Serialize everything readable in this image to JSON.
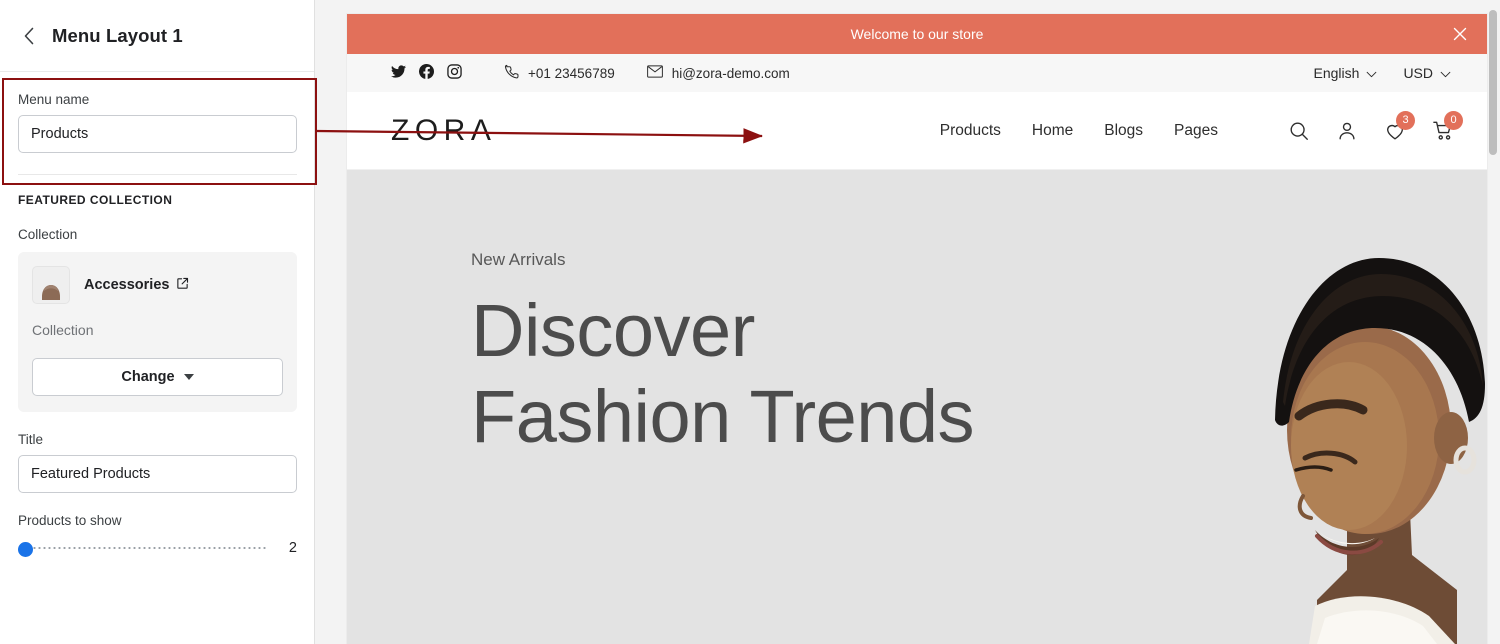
{
  "sidebar": {
    "back_icon": "chevron-left-icon",
    "title": "Menu Layout 1",
    "menu_name": {
      "label": "Menu name",
      "value": "Products"
    },
    "featured_collection": {
      "section_title": "FEATURED COLLECTION",
      "collection_label": "Collection",
      "collection_name": "Accessories",
      "external_link_icon": "external-link-icon",
      "collection_type": "Collection",
      "change_button": "Change",
      "change_caret_icon": "caret-down-icon"
    },
    "title_field": {
      "label": "Title",
      "value": "Featured Products"
    },
    "products_to_show": {
      "label": "Products to show",
      "value": "2"
    }
  },
  "annotation": {
    "box_color": "#8c1010",
    "arrow_color": "#8c1010",
    "target": "Products"
  },
  "preview": {
    "promo_bar": {
      "text": "Welcome to our store",
      "background": "#e2705a",
      "close_icon": "close-icon"
    },
    "topbar": {
      "socials": [
        {
          "name": "twitter-icon"
        },
        {
          "name": "facebook-icon"
        },
        {
          "name": "instagram-icon"
        }
      ],
      "phone_icon": "phone-icon",
      "phone": "+01 23456789",
      "email_icon": "envelope-icon",
      "email": "hi@zora-demo.com",
      "language": "English",
      "language_caret_icon": "chevron-down-icon",
      "currency": "USD",
      "currency_caret_icon": "chevron-down-icon"
    },
    "navbar": {
      "logo": "ZORA",
      "links": [
        {
          "label": "Products"
        },
        {
          "label": "Home"
        },
        {
          "label": "Blogs"
        },
        {
          "label": "Pages"
        }
      ],
      "icons": {
        "search": "search-icon",
        "account": "user-icon",
        "wishlist": "heart-icon",
        "wishlist_count": "3",
        "cart": "cart-icon",
        "cart_count": "0",
        "badge_color": "#e2705a"
      }
    },
    "hero": {
      "eyebrow": "New Arrivals",
      "title_line1": "Discover",
      "title_line2": "Fashion Trends",
      "background": "#e3e3e3"
    }
  }
}
